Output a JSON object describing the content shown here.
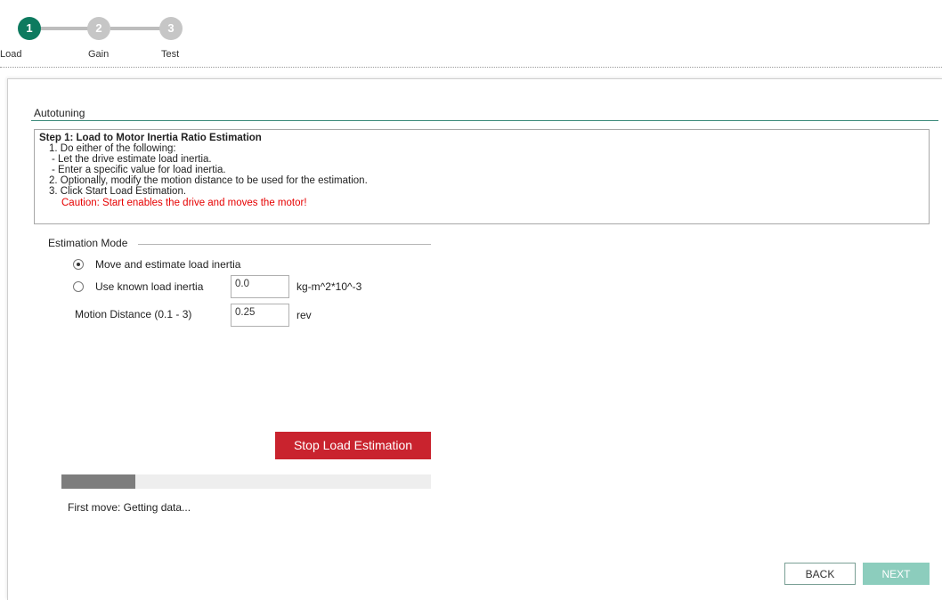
{
  "wizard": {
    "steps": [
      {
        "number": "1",
        "label": "Load",
        "state": "active"
      },
      {
        "number": "2",
        "label": "Gain",
        "state": "inactive"
      },
      {
        "number": "3",
        "label": "Test",
        "state": "inactive"
      }
    ],
    "colors": {
      "active": "#0d7a5f",
      "inactive": "#c6c6c6"
    }
  },
  "section": {
    "title": "Autotuning"
  },
  "instructions": {
    "title": "Step 1: Load to Motor Inertia Ratio Estimation",
    "line1": "1. Do either of the following:",
    "line1a": "- Let the drive estimate load inertia.",
    "line1b": "- Enter a specific value for load inertia.",
    "line2": "2. Optionally, modify the motion distance to be used for the estimation.",
    "line3": "3. Click Start Load Estimation.",
    "caution": "Caution: Start enables the drive and moves the motor!"
  },
  "estimation_mode": {
    "label": "Estimation Mode",
    "options": [
      {
        "label": "Move and estimate load inertia",
        "checked": true
      },
      {
        "label": "Use known load inertia",
        "checked": false
      }
    ],
    "inertia_value": "0.0",
    "inertia_unit": "kg-m^2*10^-3",
    "distance_label": "Motion Distance (0.1 - 3)",
    "distance_value": "0.25",
    "distance_unit": "rev"
  },
  "actions": {
    "stop_label": "Stop Load Estimation",
    "progress_fraction": 0.2,
    "status_text": "First move: Getting data..."
  },
  "nav": {
    "back_label": "BACK",
    "next_label": "NEXT"
  },
  "colors": {
    "accent": "#0d7a5f",
    "stop_button": "#c9232e",
    "caution": "#e60000",
    "next_disabled": "#8ccdbd"
  }
}
